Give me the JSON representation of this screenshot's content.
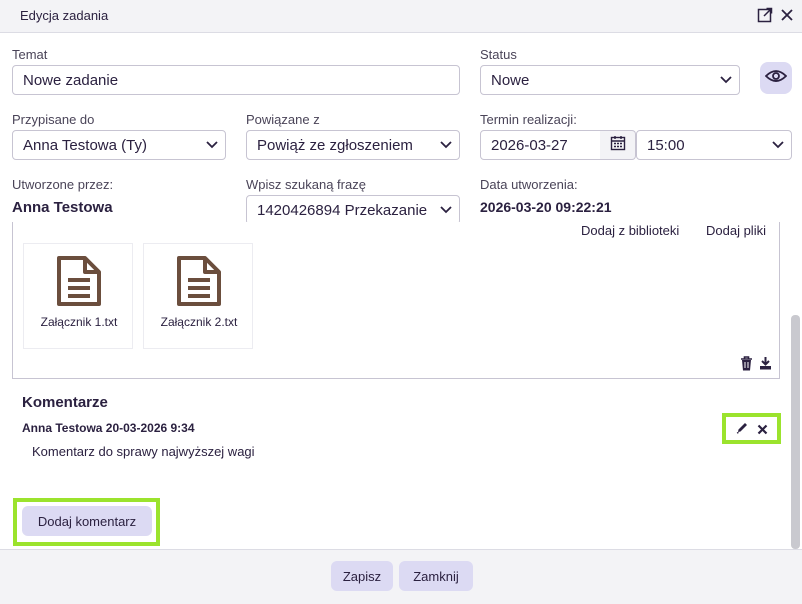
{
  "dialog": {
    "title": "Edycja zadania"
  },
  "form": {
    "temat": {
      "label": "Temat",
      "value": "Nowe zadanie"
    },
    "status": {
      "label": "Status",
      "value": "Nowe"
    },
    "przypisane": {
      "label": "Przypisane do",
      "value": "Anna Testowa (Ty)"
    },
    "powiazane": {
      "label": "Powiązane z",
      "value": "Powiąż ze zgłoszeniem"
    },
    "termin": {
      "label": "Termin realizacji:",
      "date": "2026-03-27",
      "time": "15:00"
    },
    "utworzone": {
      "label": "Utworzone przez:",
      "value": "Anna Testowa"
    },
    "szukaj": {
      "label": "Wpisz szukaną frazę",
      "value": "1420426894 Przekazanie"
    },
    "data_utworzenia": {
      "label": "Data utworzenia:",
      "value": "2026-03-20 09:22:21"
    }
  },
  "attachments": {
    "add_from_library": "Dodaj z biblioteki",
    "add_files": "Dodaj pliki",
    "files": [
      {
        "name": "Załącznik 1.txt",
        "icon": "document-icon"
      },
      {
        "name": "Załącznik 2.txt",
        "icon": "document-icon"
      }
    ]
  },
  "comments": {
    "heading": "Komentarze",
    "items": [
      {
        "author_date": "Anna Testowa 20-03-2026 9:34",
        "text": "Komentarz do sprawy najwyższej wagi"
      }
    ],
    "add_button": "Dodaj komentarz"
  },
  "footer": {
    "save": "Zapisz",
    "close": "Zamknij"
  },
  "colors": {
    "accent_button": "#dcdaf3",
    "highlight": "#9be32d",
    "file_icon": "#6b4e3d"
  }
}
